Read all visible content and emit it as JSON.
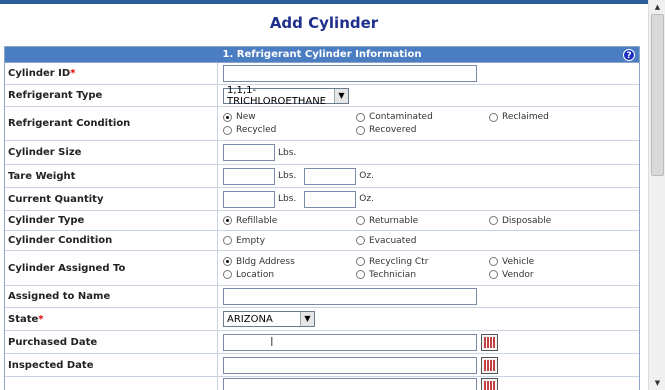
{
  "page": {
    "title": "Add Cylinder"
  },
  "section": {
    "title": "1. Refrigerant Cylinder Information",
    "help": "?"
  },
  "fields": {
    "cylinder_id": {
      "label": "Cylinder ID",
      "required": "*",
      "value": ""
    },
    "refrigerant_type": {
      "label": "Refrigerant Type",
      "value": "1,1,1-TRICHLOROETHANE"
    },
    "refrigerant_condition": {
      "label": "Refrigerant Condition",
      "options": [
        "New",
        "Contaminated",
        "Reclaimed",
        "Recycled",
        "Recovered"
      ],
      "selected": "New"
    },
    "cylinder_size": {
      "label": "Cylinder Size",
      "unit": "Lbs.",
      "value": ""
    },
    "tare_weight": {
      "label": "Tare Weight",
      "unit_lbs": "Lbs.",
      "unit_oz": "Oz.",
      "lbs": "",
      "oz": ""
    },
    "current_quantity": {
      "label": "Current Quantity",
      "unit_lbs": "Lbs.",
      "unit_oz": "Oz.",
      "lbs": "",
      "oz": ""
    },
    "cylinder_type": {
      "label": "Cylinder Type",
      "options": [
        "Refillable",
        "Returnable",
        "Disposable"
      ],
      "selected": "Refillable"
    },
    "cylinder_condition": {
      "label": "Cylinder Condition",
      "options": [
        "Empty",
        "Evacuated"
      ],
      "selected": ""
    },
    "cylinder_assigned_to": {
      "label": "Cylinder Assigned To",
      "options": [
        "Bldg Address",
        "Recycling Ctr",
        "Vehicle",
        "Location",
        "Technician",
        "Vendor"
      ],
      "selected": "Bldg Address"
    },
    "assigned_to_name": {
      "label": "Assigned to Name",
      "value": ""
    },
    "state": {
      "label": "State",
      "required": "*",
      "value": "ARIZONA"
    },
    "purchased_date": {
      "label": "Purchased Date",
      "value": ""
    },
    "inspected_date": {
      "label": "Inspected Date",
      "value": ""
    }
  },
  "icons": {
    "help": "help-icon",
    "calendar": "calendar-icon",
    "dropdown": "chevron-down-icon"
  },
  "colors": {
    "header_bg": "#4a7dc1",
    "title": "#1f2f8c",
    "required": "#dd0000"
  }
}
